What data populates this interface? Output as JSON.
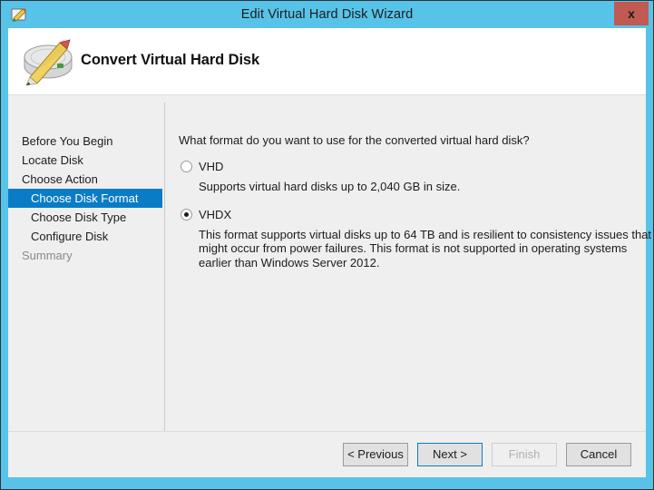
{
  "window": {
    "title": "Edit Virtual Hard Disk Wizard",
    "title_icon": "disk-pencil-icon",
    "close_label": "x",
    "frame_color": "#58c3e8"
  },
  "header": {
    "title": "Convert Virtual Hard Disk",
    "icon": "hard-disk-pencil-icon"
  },
  "sidebar": {
    "items": [
      {
        "label": "Before You Begin",
        "level": 0,
        "state": "normal"
      },
      {
        "label": "Locate Disk",
        "level": 0,
        "state": "normal"
      },
      {
        "label": "Choose Action",
        "level": 0,
        "state": "normal"
      },
      {
        "label": "Choose Disk Format",
        "level": 1,
        "state": "selected"
      },
      {
        "label": "Choose Disk Type",
        "level": 1,
        "state": "normal"
      },
      {
        "label": "Configure Disk",
        "level": 1,
        "state": "normal"
      },
      {
        "label": "Summary",
        "level": 0,
        "state": "disabled"
      }
    ],
    "selected_color": "#0a7cc7"
  },
  "main": {
    "question": "What format do you want to use for the converted virtual hard disk?",
    "options": [
      {
        "label": "VHD",
        "selected": false,
        "description": "Supports virtual hard disks up to 2,040 GB in size."
      },
      {
        "label": "VHDX",
        "selected": true,
        "description": "This format supports virtual disks up to 64 TB and is resilient to consistency issues that might occur from power failures. This format is not supported in operating systems earlier than Windows Server 2012."
      }
    ]
  },
  "footer": {
    "buttons": [
      {
        "id": "previous",
        "label": "< Previous",
        "state": "normal"
      },
      {
        "id": "next",
        "label": "Next >",
        "state": "focused"
      },
      {
        "id": "finish",
        "label": "Finish",
        "state": "disabled"
      },
      {
        "id": "cancel",
        "label": "Cancel",
        "state": "normal"
      }
    ]
  }
}
